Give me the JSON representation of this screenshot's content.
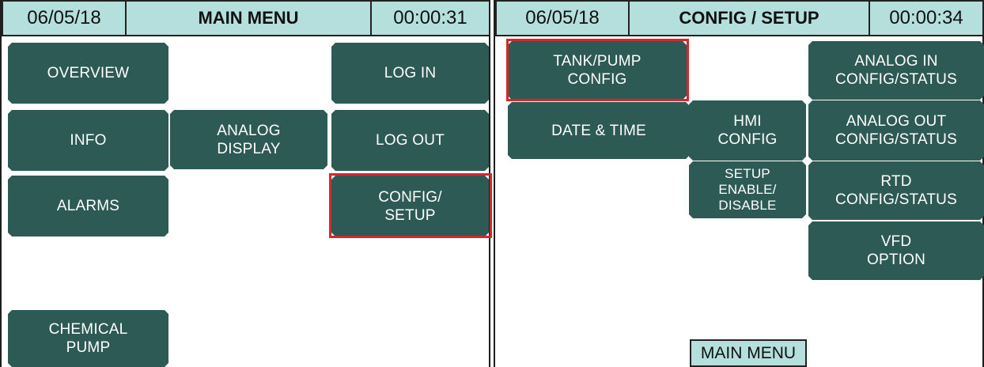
{
  "left": {
    "date": "06/05/18",
    "title": "MAIN MENU",
    "time": "00:00:31",
    "buttons": {
      "overview": "OVERVIEW",
      "login": "LOG IN",
      "info": "INFO",
      "analog_display": "ANALOG\nDISPLAY",
      "logout": "LOG OUT",
      "alarms": "ALARMS",
      "config_setup": "CONFIG/\nSETUP",
      "chemical_pump": "CHEMICAL\nPUMP"
    }
  },
  "right": {
    "date": "06/05/18",
    "title": "CONFIG / SETUP",
    "time": "00:00:34",
    "buttons": {
      "tank_pump": "TANK/PUMP\nCONFIG",
      "analog_in": "ANALOG IN\nCONFIG/STATUS",
      "date_time": "DATE & TIME",
      "hmi_config": "HMI\nCONFIG",
      "analog_out": "ANALOG OUT\nCONFIG/STATUS",
      "setup_enable": "SETUP\nENABLE/\nDISABLE",
      "rtd": "RTD\nCONFIG/STATUS",
      "vfd": "VFD\nOPTION"
    },
    "main_menu_label": "MAIN MENU"
  },
  "colors": {
    "button": "#2e5a56",
    "header": "#b5dfdc",
    "highlight": "#d9262c"
  }
}
